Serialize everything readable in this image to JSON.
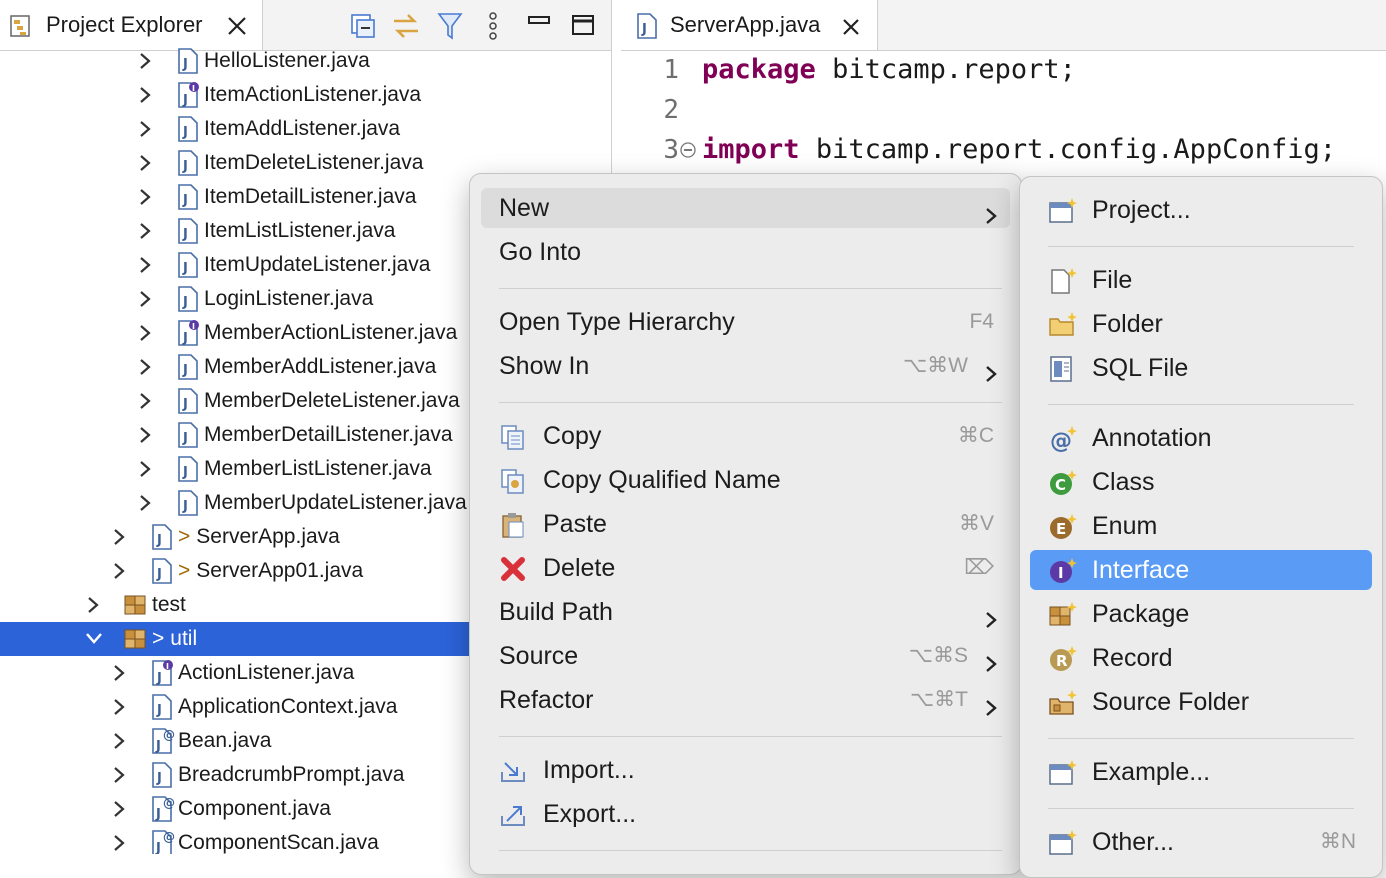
{
  "explorer": {
    "tab_title": "Project Explorer",
    "toolbar_icons": [
      "collapse-all-icon",
      "link-with-editor-icon",
      "filter-icon",
      "view-menu-icon",
      "minimize-icon",
      "maximize-icon"
    ],
    "items": [
      {
        "label": "HelloListener.java",
        "prefix": "",
        "icon": "java-file-icon",
        "indent": 2,
        "selected": false,
        "expanded": false
      },
      {
        "label": "ItemActionListener.java",
        "prefix": "",
        "icon": "java-interface-file-icon",
        "indent": 2,
        "selected": false,
        "expanded": false
      },
      {
        "label": "ItemAddListener.java",
        "prefix": "",
        "icon": "java-file-icon",
        "indent": 2,
        "selected": false,
        "expanded": false
      },
      {
        "label": "ItemDeleteListener.java",
        "prefix": "",
        "icon": "java-file-icon",
        "indent": 2,
        "selected": false,
        "expanded": false
      },
      {
        "label": "ItemDetailListener.java",
        "prefix": "",
        "icon": "java-file-icon",
        "indent": 2,
        "selected": false,
        "expanded": false
      },
      {
        "label": "ItemListListener.java",
        "prefix": "",
        "icon": "java-file-icon",
        "indent": 2,
        "selected": false,
        "expanded": false
      },
      {
        "label": "ItemUpdateListener.java",
        "prefix": "",
        "icon": "java-file-icon",
        "indent": 2,
        "selected": false,
        "expanded": false
      },
      {
        "label": "LoginListener.java",
        "prefix": "",
        "icon": "java-file-icon",
        "indent": 2,
        "selected": false,
        "expanded": false
      },
      {
        "label": "MemberActionListener.java",
        "prefix": "",
        "icon": "java-interface-file-icon",
        "indent": 2,
        "selected": false,
        "expanded": false
      },
      {
        "label": "MemberAddListener.java",
        "prefix": "",
        "icon": "java-file-icon",
        "indent": 2,
        "selected": false,
        "expanded": false
      },
      {
        "label": "MemberDeleteListener.java",
        "prefix": "",
        "icon": "java-file-icon",
        "indent": 2,
        "selected": false,
        "expanded": false
      },
      {
        "label": "MemberDetailListener.java",
        "prefix": "",
        "icon": "java-file-icon",
        "indent": 2,
        "selected": false,
        "expanded": false
      },
      {
        "label": "MemberListListener.java",
        "prefix": "",
        "icon": "java-file-icon",
        "indent": 2,
        "selected": false,
        "expanded": false
      },
      {
        "label": "MemberUpdateListener.java",
        "prefix": "",
        "icon": "java-file-icon",
        "indent": 2,
        "selected": false,
        "expanded": false
      },
      {
        "label": "ServerApp.java",
        "prefix": ">",
        "icon": "java-file-icon",
        "indent": 1,
        "selected": false,
        "expanded": false
      },
      {
        "label": "ServerApp01.java",
        "prefix": ">",
        "icon": "java-file-icon",
        "indent": 1,
        "selected": false,
        "expanded": false
      },
      {
        "label": "test",
        "prefix": "",
        "icon": "package-icon",
        "indent": 0,
        "selected": false,
        "expanded": false
      },
      {
        "label": "util",
        "prefix": ">",
        "icon": "package-icon",
        "indent": 0,
        "selected": true,
        "expanded": true
      },
      {
        "label": "ActionListener.java",
        "prefix": "",
        "icon": "java-interface-file-icon",
        "indent": 1,
        "selected": false,
        "expanded": false
      },
      {
        "label": "ApplicationContext.java",
        "prefix": "",
        "icon": "java-file-icon",
        "indent": 1,
        "selected": false,
        "expanded": false
      },
      {
        "label": "Bean.java",
        "prefix": "",
        "icon": "java-annotation-file-icon",
        "indent": 1,
        "selected": false,
        "expanded": false
      },
      {
        "label": "BreadcrumbPrompt.java",
        "prefix": "",
        "icon": "java-file-icon",
        "indent": 1,
        "selected": false,
        "expanded": false
      },
      {
        "label": "Component.java",
        "prefix": "",
        "icon": "java-annotation-file-icon",
        "indent": 1,
        "selected": false,
        "expanded": false
      },
      {
        "label": "ComponentScan.java",
        "prefix": "",
        "icon": "java-annotation-file-icon",
        "indent": 1,
        "selected": false,
        "expanded": false
      }
    ]
  },
  "editor": {
    "tab_title": "ServerApp.java",
    "lines": [
      {
        "num": "1",
        "keyword": "package",
        "rest": "bitcamp.report;"
      },
      {
        "num": "2",
        "keyword": "",
        "rest": ""
      },
      {
        "num": "3",
        "keyword": "import",
        "rest": "bitcamp.report.config.AppConfig;"
      }
    ]
  },
  "context_menu": {
    "items": [
      {
        "type": "item",
        "label": "New",
        "shortcut": "",
        "submenu": true,
        "icon": "",
        "highlight": "soft"
      },
      {
        "type": "item",
        "label": "Go Into",
        "shortcut": "",
        "submenu": false,
        "icon": ""
      },
      {
        "type": "sep"
      },
      {
        "type": "item",
        "label": "Open Type Hierarchy",
        "shortcut": "F4",
        "submenu": false,
        "icon": ""
      },
      {
        "type": "item",
        "label": "Show In",
        "shortcut": "⌥⌘W",
        "submenu": true,
        "icon": ""
      },
      {
        "type": "sep"
      },
      {
        "type": "item",
        "label": "Copy",
        "shortcut": "⌘C",
        "submenu": false,
        "icon": "copy-icon"
      },
      {
        "type": "item",
        "label": "Copy Qualified Name",
        "shortcut": "",
        "submenu": false,
        "icon": "copy-qualified-name-icon"
      },
      {
        "type": "item",
        "label": "Paste",
        "shortcut": "⌘V",
        "submenu": false,
        "icon": "paste-icon"
      },
      {
        "type": "item",
        "label": "Delete",
        "shortcut": "⌦",
        "submenu": false,
        "icon": "delete-icon"
      },
      {
        "type": "item",
        "label": "Build Path",
        "shortcut": "",
        "submenu": true,
        "icon": ""
      },
      {
        "type": "item",
        "label": "Source",
        "shortcut": "⌥⌘S",
        "submenu": true,
        "icon": ""
      },
      {
        "type": "item",
        "label": "Refactor",
        "shortcut": "⌥⌘T",
        "submenu": true,
        "icon": ""
      },
      {
        "type": "sep"
      },
      {
        "type": "item",
        "label": "Import...",
        "shortcut": "",
        "submenu": false,
        "icon": "import-icon"
      },
      {
        "type": "item",
        "label": "Export...",
        "shortcut": "",
        "submenu": false,
        "icon": "export-icon"
      },
      {
        "type": "sep"
      }
    ]
  },
  "new_submenu": {
    "items": [
      {
        "type": "item",
        "label": "Project...",
        "shortcut": "",
        "icon": "new-project-icon"
      },
      {
        "type": "sep"
      },
      {
        "type": "item",
        "label": "File",
        "shortcut": "",
        "icon": "new-file-icon"
      },
      {
        "type": "item",
        "label": "Folder",
        "shortcut": "",
        "icon": "new-folder-icon"
      },
      {
        "type": "item",
        "label": "SQL File",
        "shortcut": "",
        "icon": "sql-file-icon"
      },
      {
        "type": "sep"
      },
      {
        "type": "item",
        "label": "Annotation",
        "shortcut": "",
        "icon": "new-annotation-icon"
      },
      {
        "type": "item",
        "label": "Class",
        "shortcut": "",
        "icon": "new-class-icon"
      },
      {
        "type": "item",
        "label": "Enum",
        "shortcut": "",
        "icon": "new-enum-icon"
      },
      {
        "type": "item",
        "label": "Interface",
        "shortcut": "",
        "icon": "new-interface-icon",
        "highlight": "strong"
      },
      {
        "type": "item",
        "label": "Package",
        "shortcut": "",
        "icon": "new-package-icon"
      },
      {
        "type": "item",
        "label": "Record",
        "shortcut": "",
        "icon": "new-record-icon"
      },
      {
        "type": "item",
        "label": "Source Folder",
        "shortcut": "",
        "icon": "new-source-folder-icon"
      },
      {
        "type": "sep"
      },
      {
        "type": "item",
        "label": "Example...",
        "shortcut": "",
        "icon": "new-example-icon"
      },
      {
        "type": "sep"
      },
      {
        "type": "item",
        "label": "Other...",
        "shortcut": "⌘N",
        "icon": "new-other-icon"
      }
    ]
  },
  "colors": {
    "selection": "#2c63d9",
    "menu_highlight": "#5a9bf5",
    "keyword": "#7f0055"
  }
}
